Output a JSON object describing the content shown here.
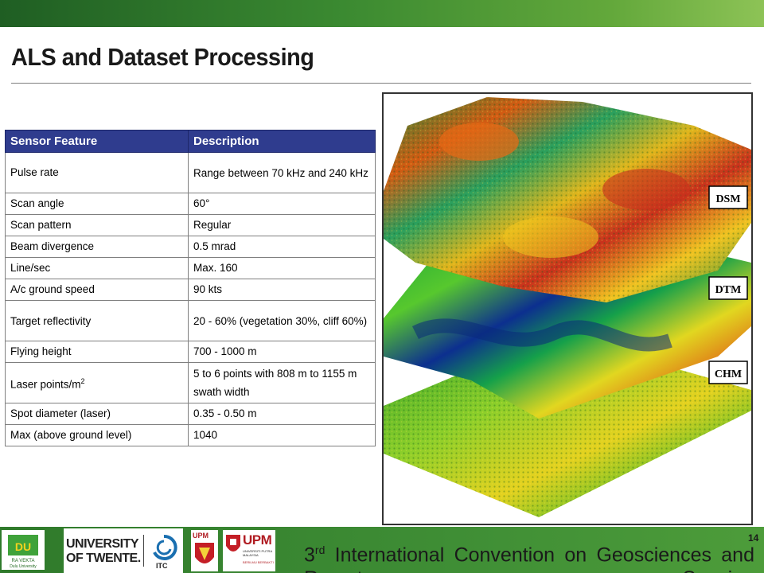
{
  "slide": {
    "title": "ALS and Dataset Processing",
    "page_number": "14"
  },
  "table": {
    "headers": [
      "Sensor Feature",
      "Description"
    ],
    "rows": [
      {
        "feature": "Pulse rate",
        "description": "Range between 70 kHz and 240 kHz"
      },
      {
        "feature": "Scan angle",
        "description": "60°"
      },
      {
        "feature": "Scan pattern",
        "description": "Regular"
      },
      {
        "feature": "Beam divergence",
        "description": "0.5 mrad"
      },
      {
        "feature": "Line/sec",
        "description": "Max. 160"
      },
      {
        "feature": "A/c ground speed",
        "description": "90 kts"
      },
      {
        "feature": "Target reflectivity",
        "description": "20 - 60% (vegetation 30%, cliff 60%)"
      },
      {
        "feature": "Flying height",
        "description": "700 - 1000 m"
      },
      {
        "feature_main": "Laser points/m",
        "feature_sup": "2",
        "description": "5 to 6 points with 808 m to 1155 m swath width"
      },
      {
        "feature": "Spot diameter (laser)",
        "description": "0.35 - 0.50 m"
      },
      {
        "feature": "Max (above ground level)",
        "description": "1040"
      }
    ]
  },
  "figure": {
    "labels": {
      "dsm": "DSM",
      "dtm": "DTM",
      "chm": "CHM"
    }
  },
  "footer": {
    "convention_sup": "rd",
    "convention_text": "International Convention on Geosciences and Remote Sensing",
    "ordinal": "3",
    "logos": {
      "twente_line1": "UNIVERSITY",
      "twente_line2": "OF TWENTE.",
      "itc": "ITC",
      "upm_small": "UPM",
      "upm_big": "UPM",
      "upm_sub": "UNIVERSITI PUTRA MALAYSIA",
      "upm_tag": "BERILMU BERBAKTI",
      "ra_line1": "RA VEKTA",
      "ra_line2": "Dulu University"
    }
  },
  "colors": {
    "header_bg": "#2f3c8e",
    "green_bar": "#3b8a31"
  }
}
